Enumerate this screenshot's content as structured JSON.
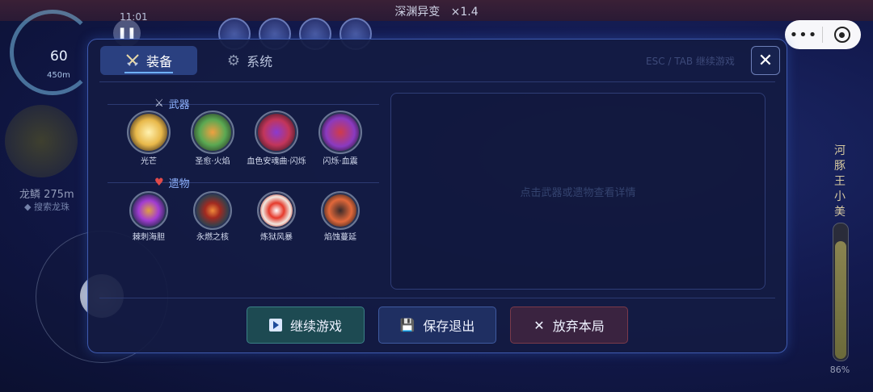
{
  "game": {
    "title": "深渊异变",
    "speed": "×1.4",
    "gauge_value": "60",
    "gauge_depth": "450m",
    "clock": "11:01",
    "nearby_target": "龙鳞 275m",
    "nearby_sub": "◆ 搜索龙珠",
    "boss_name": [
      "河",
      "豚",
      "王",
      "小",
      "美"
    ],
    "boss_health_percent": 86,
    "boss_health_label": "86%"
  },
  "wechat": {
    "more_icon": "more-dots-icon",
    "close_icon": "target-icon"
  },
  "dialog": {
    "tabs": [
      {
        "label": "装备",
        "icon": "crossed-swords-icon",
        "active": true
      },
      {
        "label": "系统",
        "icon": "gear-icon",
        "active": false
      }
    ],
    "hint": "ESC / TAB 继续游戏",
    "weapons_section": "武器",
    "relics_section": "遗物",
    "weapons": [
      {
        "name": "光芒",
        "color": "#f3d45a"
      },
      {
        "name": "圣愈·火焰",
        "color": "#7fd06a"
      },
      {
        "name": "血色安魂曲·闪烁",
        "color": "#c2355a"
      },
      {
        "name": "闪烁·血震",
        "color": "#b6345e"
      }
    ],
    "relics": [
      {
        "name": "棘刺海胆",
        "color": "#a23cd2"
      },
      {
        "name": "永燃之核",
        "color": "#e5552d"
      },
      {
        "name": "炼狱风暴",
        "color": "#e53a2b"
      },
      {
        "name": "焰蚀蔓延",
        "color": "#e2683a"
      }
    ],
    "detail_placeholder": "点击武器或遗物查看详情",
    "buttons": {
      "continue": "继续游戏",
      "save": "保存退出",
      "quit": "放弃本局"
    }
  }
}
